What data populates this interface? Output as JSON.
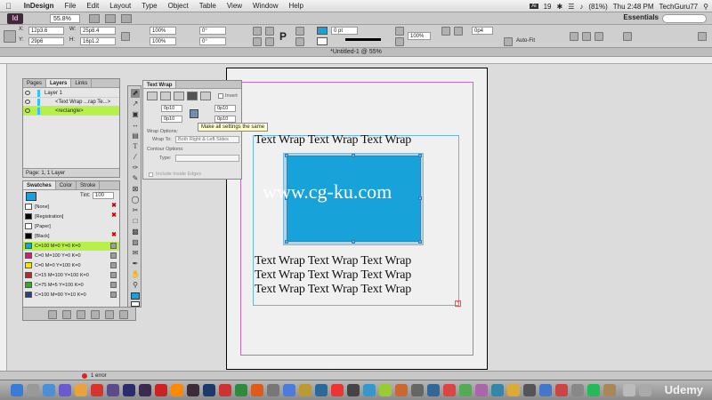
{
  "menubar": {
    "app_name": "InDesign",
    "items": [
      "File",
      "Edit",
      "Layout",
      "Type",
      "Object",
      "Table",
      "View",
      "Window",
      "Help"
    ],
    "battery": "(81%)",
    "clock": "Thu 2:48 PM",
    "user": "TechGuru77",
    "ai_badge": "19"
  },
  "appbar": {
    "logo": "Id",
    "zoom": "55.8%",
    "workspace": "Essentials"
  },
  "control": {
    "x": "12p3.6",
    "y": "29p6",
    "w": "25p8.4",
    "h": "16p1.2",
    "scale_x": "100%",
    "scale_y": "100%",
    "angle": "0°",
    "shear": "0°",
    "stroke_w": "0 pt",
    "opacity": "100%",
    "offset": "0p4",
    "autofit": "Auto-Fit"
  },
  "document": {
    "title": "*Untitled-1 @ 55%"
  },
  "canvas": {
    "text_line": "Text Wrap Text Wrap Text Wrap",
    "watermark": "www.cg-ku.com"
  },
  "layers_panel": {
    "tabs": [
      "Pages",
      "Layers",
      "Links"
    ],
    "rows": [
      "Layer 1",
      "<Text Wrap ...rap Te...>",
      "<rectangle>"
    ],
    "footer": "Page: 1, 1 Layer"
  },
  "swatches_panel": {
    "tabs": [
      "Swatches",
      "Color",
      "Stroke"
    ],
    "tint_label": "Tint:",
    "tint": "100",
    "swatches": [
      {
        "name": "[None]",
        "color": "#ffffff"
      },
      {
        "name": "[Registration]",
        "color": "#000000"
      },
      {
        "name": "[Paper]",
        "color": "#ffffff"
      },
      {
        "name": "[Black]",
        "color": "#000000"
      },
      {
        "name": "C=100 M=0 Y=0 K=0",
        "color": "#17a2da"
      },
      {
        "name": "C=0 M=100 Y=0 K=0",
        "color": "#e0147a"
      },
      {
        "name": "C=0 M=0 Y=100 K=0",
        "color": "#f5e600"
      },
      {
        "name": "C=15 M=100 Y=100 K=0",
        "color": "#c8202a"
      },
      {
        "name": "C=75 M=5 Y=100 K=0",
        "color": "#3aa535"
      },
      {
        "name": "C=100 M=90 Y=10 K=0",
        "color": "#2a3d8f"
      }
    ]
  },
  "textwrap_panel": {
    "title": "Text Wrap",
    "invert": "Invert",
    "top": "0p10",
    "bottom": "0p10",
    "left": "0p10",
    "right": "0p10",
    "wrap_options": "Wrap Options:",
    "wrap_to_label": "Wrap To:",
    "wrap_to": "Both Right & Left Sides",
    "contour_options": "Contour Options:",
    "type_label": "Type:",
    "include_inside": "Include Inside Edges",
    "tooltip": "Make all settings the same"
  },
  "status": {
    "errors": "1 error"
  },
  "dock": {
    "watermark": "Udemy"
  }
}
